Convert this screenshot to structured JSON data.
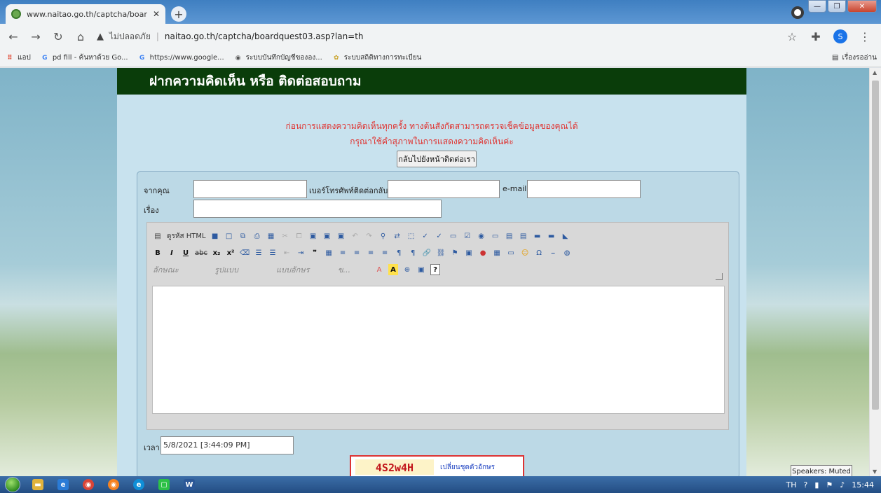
{
  "browser": {
    "tab_title": "www.naitao.go.th/captcha/board",
    "tab_close": "✕",
    "new_tab": "+",
    "security_label": "ไม่ปลอดภัย",
    "url": "naitao.go.th/captcha/boardquest03.asp?lan=th",
    "profile_initial": "S",
    "reading_list": "เรื่องรออ่าน"
  },
  "bookmarks": [
    {
      "label": "แอป",
      "icon": "apps-grid-icon"
    },
    {
      "label": "pd fill - ค้นหาด้วย Go...",
      "icon": "google-g-icon"
    },
    {
      "label": "https://www.google...",
      "icon": "google-g-icon"
    },
    {
      "label": "ระบบบันทึกบัญชีขององ...",
      "icon": "site-globe-icon"
    },
    {
      "label": "ระบบสถิติทางการทะเบียน",
      "icon": "site-emblem-icon"
    }
  ],
  "page": {
    "header_title": "ฝากความคิดเห็น หรือ ติดต่อสอบถาม",
    "notice_line1": "ก่อนการแสดงความคิดเห็นทุกครั้ง ทางต้นสังกัดสามารถตรวจเช็คข้อมูลของคุณได้",
    "notice_line2": "กรุณาใช้คำสุภาพในการแสดงความคิดเห็นค่ะ",
    "back_button": "กลับไปยังหน้าติดต่อเรา",
    "form": {
      "from_label": "จากคุณ",
      "phone_label": "เบอร์โทรศัพท์ติดต่อกลับ",
      "email_label": "e-mail",
      "subject_label": "เรื่อง",
      "time_label": "เวลา",
      "time_value": "5/8/2021 [3:44:09 PM]"
    },
    "editor": {
      "source_html": "ดูรหัส HTML",
      "style_combo": "ลักษณะ",
      "format_combo": "รูปแบบ",
      "font_combo": "แบบอักษร",
      "size_combo": "ข..."
    },
    "captcha": {
      "code": "4S2w4H",
      "refresh_link": "เปลี่ยนชุดตัวอักษร"
    }
  },
  "taskbar": {
    "language": "TH",
    "clock": "15:44",
    "tooltip": "Speakers: Muted"
  }
}
